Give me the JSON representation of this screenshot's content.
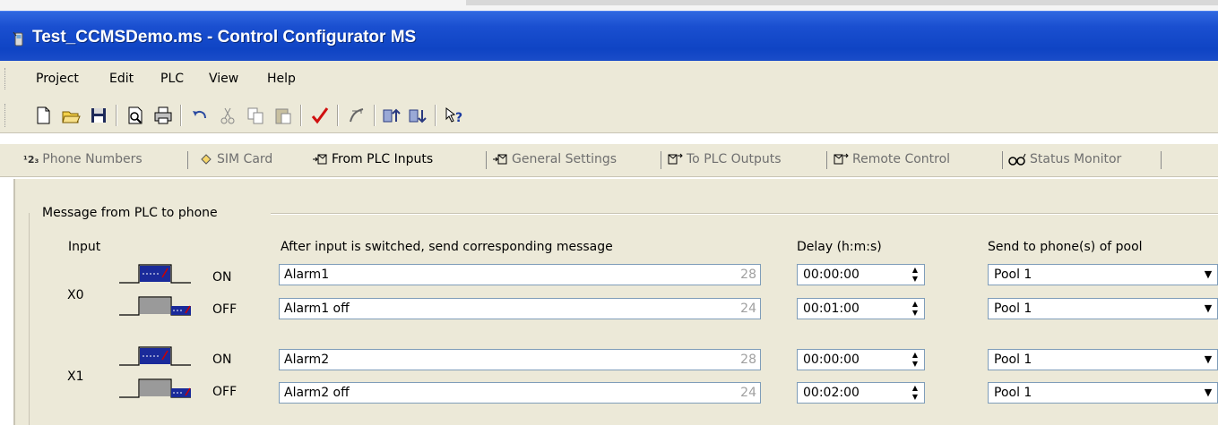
{
  "window": {
    "title": "Test_CCMSDemo.ms - Control Configurator MS"
  },
  "menu": {
    "items": [
      "Project",
      "Edit",
      "PLC",
      "View",
      "Help"
    ]
  },
  "toolbar": {
    "icons": [
      "new-file-icon",
      "open-folder-icon",
      "save-icon",
      "print-preview-icon",
      "print-icon",
      "undo-icon",
      "cut-icon",
      "copy-icon",
      "paste-icon",
      "check-icon",
      "edit-script-icon",
      "upload-icon",
      "download-icon",
      "help-icon"
    ]
  },
  "tabs": [
    {
      "label": "Phone Numbers",
      "active": false
    },
    {
      "label": "SIM Card",
      "active": false
    },
    {
      "label": "From PLC Inputs",
      "active": true
    },
    {
      "label": "General Settings",
      "active": false
    },
    {
      "label": "To PLC Outputs",
      "active": false
    },
    {
      "label": "Remote Control",
      "active": false
    },
    {
      "label": "Status Monitor",
      "active": false
    }
  ],
  "tab_prefix": {
    "phone_numbers": "¹2₃"
  },
  "content": {
    "group_title": "Message from PLC to phone",
    "col_input": "Input",
    "col_message": "After input is switched, send corresponding message",
    "col_delay": "Delay (h:m:s)",
    "col_pool": "Send to phone(s) of pool",
    "inputs": [
      {
        "name": "X0",
        "rows": [
          {
            "state": "ON",
            "message": "Alarm1",
            "count": "28",
            "delay": "00:00:00",
            "pool": "Pool 1"
          },
          {
            "state": "OFF",
            "message": "Alarm1 off",
            "count": "24",
            "delay": "00:01:00",
            "pool": "Pool 1"
          }
        ]
      },
      {
        "name": "X1",
        "rows": [
          {
            "state": "ON",
            "message": "Alarm2",
            "count": "28",
            "delay": "00:00:00",
            "pool": "Pool 1"
          },
          {
            "state": "OFF",
            "message": "Alarm2 off",
            "count": "24",
            "delay": "00:02:00",
            "pool": "Pool 1"
          }
        ]
      }
    ]
  },
  "colors": {
    "titlebar": "#0f44c4",
    "face": "#ece9d8",
    "field_border": "#7f9db9",
    "counter": "#a0a0a0"
  }
}
